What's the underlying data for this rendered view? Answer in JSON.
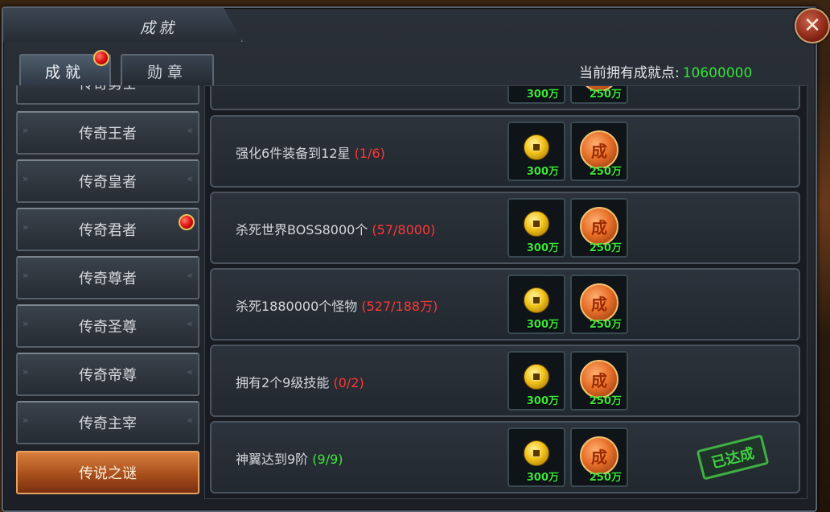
{
  "window": {
    "title": "成就",
    "close_label": "✕"
  },
  "tabs": [
    {
      "label": "成就",
      "active": true,
      "has_alert": true
    },
    {
      "label": "勋章",
      "active": false,
      "has_alert": false
    }
  ],
  "points": {
    "label": "当前拥有成就点:",
    "value": "10600000"
  },
  "sidebar": {
    "items": [
      {
        "label": "传奇勇士",
        "partial": true
      },
      {
        "label": "传奇王者"
      },
      {
        "label": "传奇皇者"
      },
      {
        "label": "传奇君者",
        "has_alert": true
      },
      {
        "label": "传奇尊者"
      },
      {
        "label": "传奇圣尊"
      },
      {
        "label": "传奇帝尊"
      },
      {
        "label": "传奇主宰"
      },
      {
        "label": "传说之谜",
        "active": true
      }
    ]
  },
  "medal_glyph": "成",
  "achievements": [
    {
      "desc": "",
      "progress": "",
      "coin_qty": "300万",
      "medal_qty": "250万",
      "partial": true
    },
    {
      "desc": "强化6件装备到12星",
      "progress": "(1/6)",
      "status": "incomplete",
      "coin_qty": "300万",
      "medal_qty": "250万"
    },
    {
      "desc": "杀死世界BOSS8000个",
      "progress": "(57/8000)",
      "status": "incomplete",
      "coin_qty": "300万",
      "medal_qty": "250万"
    },
    {
      "desc": "杀死1880000个怪物",
      "progress": "(527/188万)",
      "status": "incomplete",
      "coin_qty": "300万",
      "medal_qty": "250万"
    },
    {
      "desc": "拥有2个9级技能",
      "progress": "(0/2)",
      "status": "incomplete",
      "coin_qty": "300万",
      "medal_qty": "250万"
    },
    {
      "desc": "神翼达到9阶",
      "progress": "(9/9)",
      "status": "complete",
      "stamp": "已达成",
      "coin_qty": "300万",
      "medal_qty": "250万"
    }
  ],
  "colors": {
    "progress_incomplete": "#ff3636",
    "progress_complete": "#3ce63a",
    "points_value": "#35e23a",
    "active_sidebar": "#c4602a"
  }
}
